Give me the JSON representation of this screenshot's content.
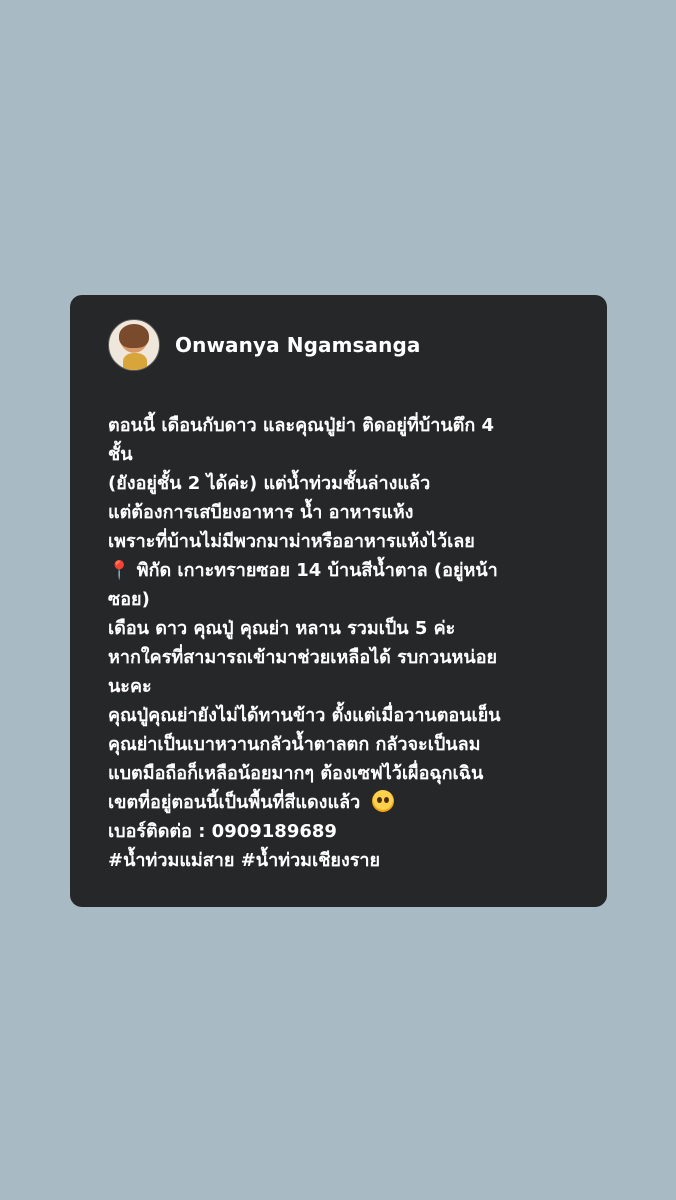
{
  "post": {
    "author": {
      "name": "Onwanya Ngamsanga",
      "avatar_icon": "profile-avatar"
    },
    "body_lines": [
      "ตอนนี้ เดือนกับดาว และคุณปู่ย่า ติดอยู่ที่บ้านตึก 4",
      "ชั้น",
      "(ยังอยู่ชั้น 2 ได้ค่ะ) แต่น้ำท่วมชั้นล่างแล้ว",
      "แต่ต้องการเสบียงอาหาร น้ำ อาหารแห้ง",
      "เพราะที่บ้านไม่มีพวกมาม่าหรืออาหารแห้งไว้เลย",
      "พิกัด เกาะทรายซอย 14 บ้านสีน้ำตาล (อยู่หน้า",
      "ซอย)",
      "เดือน ดาว คุณปู่ คุณย่า หลาน รวมเป็น 5 ค่ะ",
      "หากใครที่สามารถเข้ามาช่วยเหลือได้ รบกวนหน่อย",
      "นะคะ",
      "คุณปู่คุณย่ายังไม่ได้ทานข้าว ตั้งแต่เมื่อวานตอนเย็น",
      "คุณย่าเป็นเบาหวานกลัวน้ำตาลตก กลัวจะเป็นลม",
      "แบตมือถือก็เหลือน้อยมากๆ ต้องเซฟไว้เผื่อฉุกเฉิน",
      "เขตที่อยู่ตอนนี้เป็นพื้นที่สีแดงแล้ว",
      "เบอร์ติดต่อ : 0909189689",
      "#น้ำท่วมแม่สาย  #น้ำท่วมเชียงราย"
    ],
    "pin_icon": "round-pushpin",
    "pin_glyph": "📍",
    "emoji_icon": "pleading-face"
  },
  "colors": {
    "page_background": "#a8bac3",
    "card_background": "#262729",
    "text": "#ffffff",
    "pin": "#d83b35",
    "emoji": "#ffd24d"
  }
}
